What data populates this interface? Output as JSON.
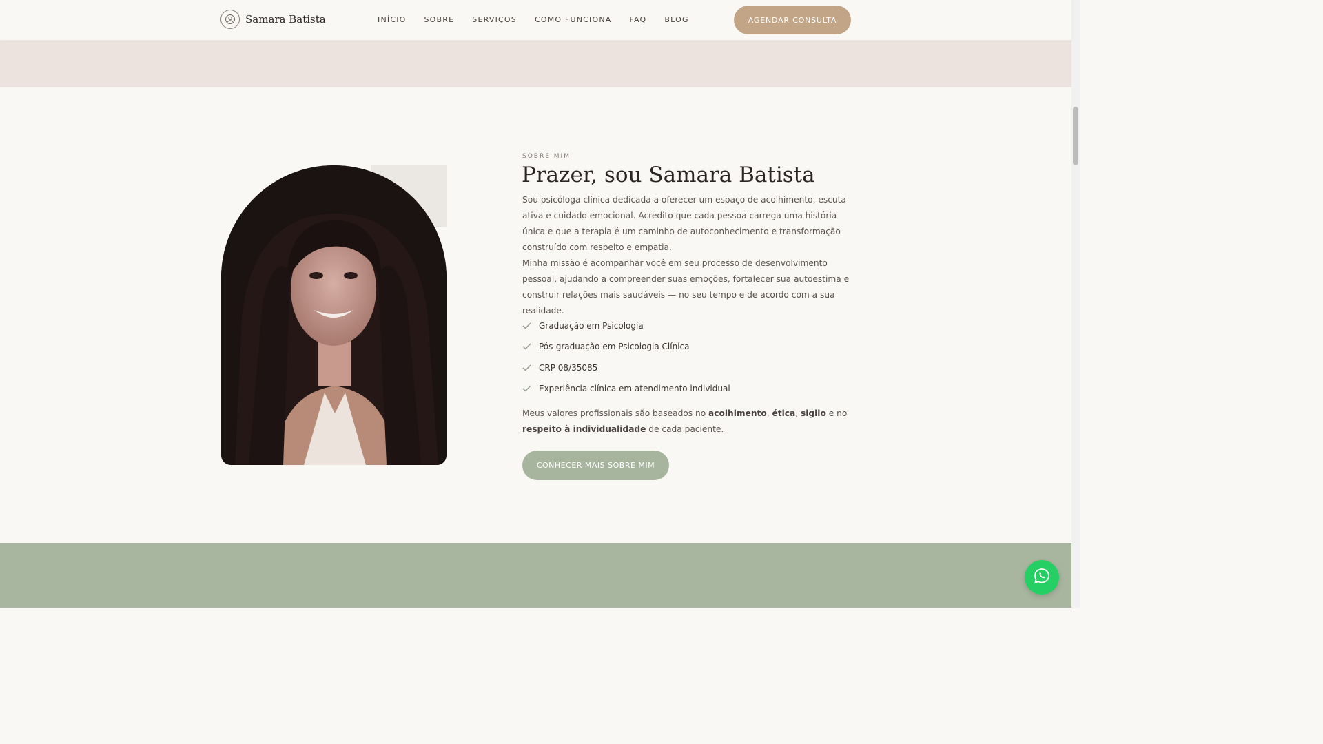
{
  "header": {
    "brand": "Samara Batista",
    "nav": [
      "INÍCIO",
      "SOBRE",
      "SERVIÇOS",
      "COMO FUNCIONA",
      "FAQ",
      "BLOG"
    ],
    "cta": "AGENDAR CONSULTA"
  },
  "about": {
    "eyebrow": "SOBRE MIM",
    "title": "Prazer, sou Samara Batista",
    "p1": "Sou psicóloga clínica dedicada a oferecer um espaço de acolhimento, escuta ativa e cuidado emocional. Acredito que cada pessoa carrega uma história única e que a terapia é um caminho de autoconhecimento e transformação construído com respeito e empatia.",
    "p2": "Minha missão é acompanhar você em seu processo de desenvolvimento pessoal, ajudando a compreender suas emoções, fortalecer sua autoestima e construir relações mais saudáveis — no seu tempo e de acordo com a sua realidade.",
    "credentials": [
      "Graduação em Psicologia",
      "Pós-graduação em Psicologia Clínica",
      "CRP 08/35085",
      "Experiência clínica em atendimento individual"
    ],
    "values_intro": "Meus valores profissionais são baseados no ",
    "values_1": "acolhimento",
    "values_sep1": ", ",
    "values_2": "ética",
    "values_sep2": ", ",
    "values_3": "sigilo",
    "values_and": " e no ",
    "values_4": "respeito à individualidade",
    "values_end": " de cada paciente.",
    "button": "CONHECER MAIS SOBRE MIM"
  },
  "colors": {
    "accent": "#c2a586",
    "sage": "#a8b59e",
    "whatsapp": "#25cf63"
  }
}
